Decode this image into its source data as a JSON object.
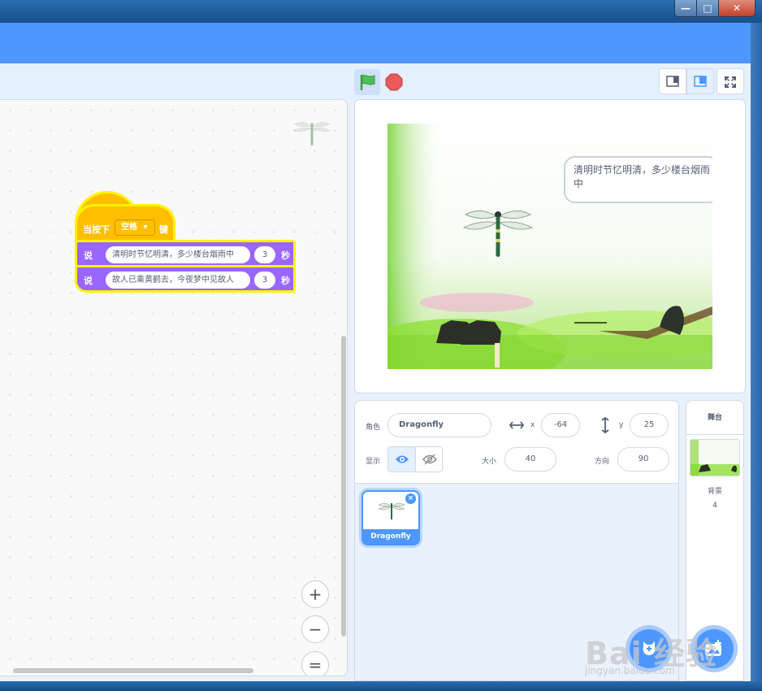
{
  "window": {
    "minimize": "—",
    "maximize": "□",
    "close": "✕"
  },
  "code": {
    "hat": {
      "prefix": "当按下",
      "key": "空格",
      "suffix": "键"
    },
    "say_blocks": [
      {
        "verb": "说",
        "text": "清明时节忆明清，多少楼台烟雨中",
        "secs": "3",
        "unit": "秒"
      },
      {
        "verb": "说",
        "text": "故人已乘黄鹤去，今夜梦中见故人",
        "secs": "3",
        "unit": "秒"
      }
    ],
    "zoom_in": "+",
    "zoom_out": "−",
    "zoom_reset": "="
  },
  "stage": {
    "speech_bubble": "清明时节忆明清，多少楼台烟雨中"
  },
  "sprite_info": {
    "sprite_label": "角色",
    "sprite_name": "Dragonfly",
    "x_label": "x",
    "x_value": "-64",
    "y_label": "y",
    "y_value": "25",
    "show_label": "显示",
    "size_label": "大小",
    "size_value": "40",
    "direction_label": "方向",
    "direction_value": "90"
  },
  "sprite_list": [
    {
      "name": "Dragonfly"
    }
  ],
  "stage_target": {
    "title": "舞台",
    "backdrops_label": "背景",
    "backdrops_count": "4"
  },
  "watermark": {
    "main": "Bai 经验",
    "sub": "jingyan.baidu.com"
  },
  "colors": {
    "menu_blue": "#4d97ff",
    "events_yellow": "#ffbf00",
    "looks_purple": "#9966ff",
    "highlight_yellow": "#fff200",
    "stop_red": "#ec5959",
    "flag_green": "#4cbf56"
  }
}
